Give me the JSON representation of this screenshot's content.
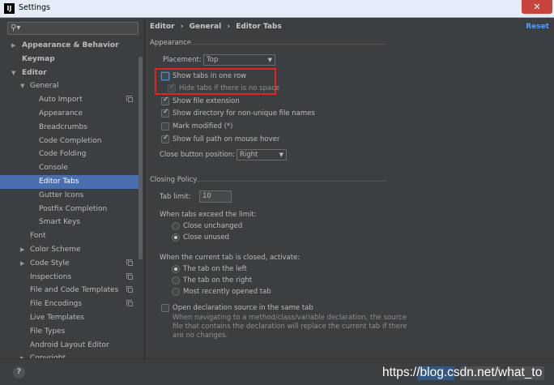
{
  "window": {
    "title": "Settings",
    "app_icon": "IJ",
    "close_glyph": "✕"
  },
  "search": {
    "placeholder": ""
  },
  "tree": [
    {
      "label": "Appearance & Behavior",
      "arrow": "▶",
      "bold": true
    },
    {
      "label": "Keymap",
      "bold": true
    },
    {
      "label": "Editor",
      "arrow": "▼",
      "bold": true
    },
    {
      "label": "General",
      "arrow": "▼"
    },
    {
      "label": "Auto Import",
      "copy": true
    },
    {
      "label": "Appearance"
    },
    {
      "label": "Breadcrumbs"
    },
    {
      "label": "Code Completion"
    },
    {
      "label": "Code Folding"
    },
    {
      "label": "Console"
    },
    {
      "label": "Editor Tabs",
      "selected": true
    },
    {
      "label": "Gutter Icons"
    },
    {
      "label": "Postfix Completion"
    },
    {
      "label": "Smart Keys"
    },
    {
      "label": "Font"
    },
    {
      "label": "Color Scheme",
      "arrow": "▶"
    },
    {
      "label": "Code Style",
      "arrow": "▶",
      "copy": true
    },
    {
      "label": "Inspections",
      "copy": true
    },
    {
      "label": "File and Code Templates",
      "copy": true
    },
    {
      "label": "File Encodings",
      "copy": true
    },
    {
      "label": "Live Templates"
    },
    {
      "label": "File Types"
    },
    {
      "label": "Android Layout Editor"
    },
    {
      "label": "Copyright",
      "arrow": "▶"
    }
  ],
  "breadcrumb": [
    "Editor",
    "›",
    "General",
    "›",
    "Editor Tabs"
  ],
  "reset_label": "Reset",
  "appearance": {
    "section": "Appearance",
    "placement_label": "Placement:",
    "placement_value": "Top",
    "show_tabs_one_row": "Show tabs in one row",
    "hide_tabs_no_space": "Hide tabs if there is no space",
    "show_file_extension": "Show file extension",
    "show_directory": "Show directory for non-unique file names",
    "mark_modified": "Mark modified (*)",
    "show_full_path": "Show full path on mouse hover",
    "close_button_label": "Close button position:",
    "close_button_value": "Right"
  },
  "closing": {
    "section": "Closing Policy",
    "tab_limit_label": "Tab limit:",
    "tab_limit_value": "10",
    "exceed_label": "When tabs exceed the limit:",
    "close_unchanged": "Close unchanged",
    "close_unused": "Close unused",
    "activate_label": "When the current tab is closed, activate:",
    "tab_left": "The tab on the left",
    "tab_right": "The tab on the right",
    "most_recent": "Most recently opened tab",
    "open_decl": "Open declaration source in the same tab",
    "open_decl_desc_1": "When navigating to a method/class/variable declaration, the source",
    "open_decl_desc_2": "file that contains the declaration will replace the current tab if there",
    "open_decl_desc_3": "are no changes."
  },
  "footer": {
    "help": "?",
    "watermark": "https://blog.csdn.net/what_to"
  },
  "colors": {
    "accent": "#4b6eaf",
    "highlight_box": "#e02424",
    "link": "#589df6"
  }
}
